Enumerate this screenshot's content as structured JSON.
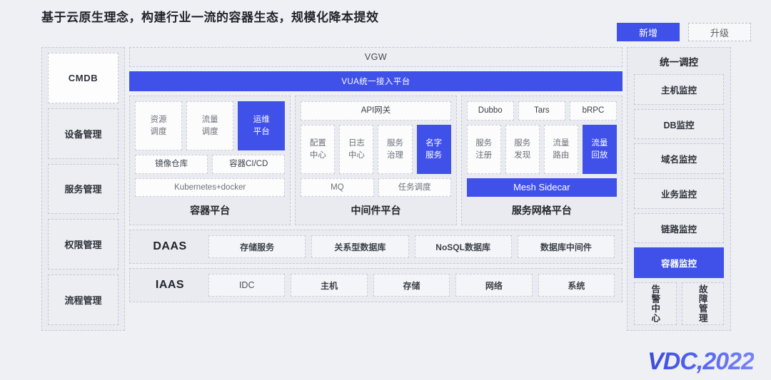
{
  "header": {
    "title": "基于云原生理念，构建行业一流的容器生态，规模化降本提效",
    "buttons": [
      {
        "label": "新增",
        "style": "primary"
      },
      {
        "label": "升级",
        "style": "ghost"
      }
    ]
  },
  "colors": {
    "accent": "#3f51e8",
    "page_bg": "#eef0f4",
    "panel_bg": "#e9ebf0",
    "cell_bg": "#fcfcfd"
  },
  "left_column": {
    "items": [
      {
        "label": "CMDB",
        "highlight": "white"
      },
      {
        "label": "设备管理",
        "highlight": "none"
      },
      {
        "label": "服务管理",
        "highlight": "none"
      },
      {
        "label": "权限管理",
        "highlight": "none"
      },
      {
        "label": "流程管理",
        "highlight": "none"
      }
    ]
  },
  "center": {
    "vgw_bar": "VGW",
    "vua_bar": "VUA统一接入平台",
    "platforms": [
      {
        "label": "容器平台",
        "rows": [
          {
            "cells": [
              {
                "label": "资源调度",
                "lines": [
                  "资源",
                  "调度"
                ],
                "blue": false
              },
              {
                "label": "流量调度",
                "lines": [
                  "流量",
                  "调度"
                ],
                "blue": false
              },
              {
                "label": "运维平台",
                "lines": [
                  "运维",
                  "平台"
                ],
                "blue": true
              }
            ]
          },
          {
            "cells": [
              {
                "label": "镜像仓库",
                "lines": [
                  "镜像仓库"
                ],
                "blue": false
              },
              {
                "label": "容器CI/CD",
                "lines": [
                  "容器CI/CD"
                ],
                "blue": false
              }
            ]
          },
          {
            "cells": [
              {
                "label": "Kubernetes+docker",
                "lines": [
                  "Kubernetes+docker"
                ],
                "blue": false
              }
            ]
          }
        ]
      },
      {
        "label": "中间件平台",
        "rows": [
          {
            "cells": [
              {
                "label": "API网关",
                "lines": [
                  "API网关"
                ],
                "blue": false
              }
            ]
          },
          {
            "cells": [
              {
                "label": "配置中心",
                "lines": [
                  "配置",
                  "中心"
                ],
                "blue": false
              },
              {
                "label": "日志中心",
                "lines": [
                  "日志",
                  "中心"
                ],
                "blue": false
              },
              {
                "label": "服务治理",
                "lines": [
                  "服务",
                  "治理"
                ],
                "blue": false
              },
              {
                "label": "名字服务",
                "lines": [
                  "名字",
                  "服务"
                ],
                "blue": true
              }
            ]
          },
          {
            "cells": [
              {
                "label": "MQ",
                "lines": [
                  "MQ"
                ],
                "blue": false
              },
              {
                "label": "任务调度",
                "lines": [
                  "任务调度"
                ],
                "blue": false
              }
            ]
          }
        ]
      },
      {
        "label": "服务网格平台",
        "rows": [
          {
            "cells": [
              {
                "label": "Dubbo",
                "lines": [
                  "Dubbo"
                ],
                "blue": false
              },
              {
                "label": "Tars",
                "lines": [
                  "Tars"
                ],
                "blue": false
              },
              {
                "label": "bRPC",
                "lines": [
                  "bRPC"
                ],
                "blue": false
              }
            ]
          },
          {
            "cells": [
              {
                "label": "服务注册",
                "lines": [
                  "服务",
                  "注册"
                ],
                "blue": false
              },
              {
                "label": "服务发现",
                "lines": [
                  "服务",
                  "发现"
                ],
                "blue": false
              },
              {
                "label": "流量路由",
                "lines": [
                  "流量",
                  "路由"
                ],
                "blue": false
              },
              {
                "label": "流量回放",
                "lines": [
                  "流量",
                  "回放"
                ],
                "blue": true
              }
            ]
          },
          {
            "cells": [
              {
                "label": "Mesh Sidecar",
                "lines": [
                  "Mesh Sidecar"
                ],
                "blue": true,
                "solid": true
              }
            ]
          }
        ]
      }
    ],
    "tiers": [
      {
        "name": "DAAS",
        "cells": [
          "存储服务",
          "关系型数据库",
          "NoSQL数据库",
          "数据库中间件"
        ]
      },
      {
        "name": "IAAS",
        "cells": [
          "IDC",
          "主机",
          "存储",
          "网络",
          "系统"
        ]
      }
    ]
  },
  "right_column": {
    "header": "统一调控",
    "items": [
      {
        "label": "主机监控",
        "blue": false
      },
      {
        "label": "DB监控",
        "blue": false
      },
      {
        "label": "域名监控",
        "blue": false
      },
      {
        "label": "业务监控",
        "blue": false
      },
      {
        "label": "链路监控",
        "blue": false
      },
      {
        "label": "容器监控",
        "blue": true
      }
    ],
    "pair": [
      {
        "label": "告警中心"
      },
      {
        "label": "故障管理"
      }
    ]
  },
  "logo": {
    "text": "VDC,2022"
  }
}
